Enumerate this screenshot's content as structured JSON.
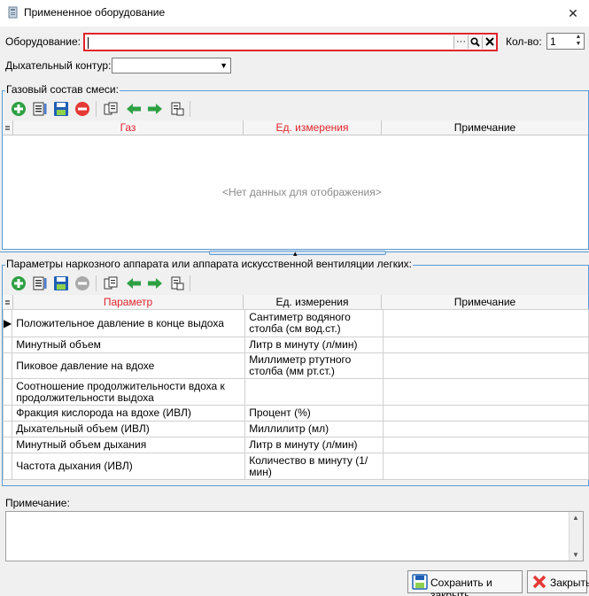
{
  "window": {
    "title": "Примененное оборудование",
    "close_glyph": "✕"
  },
  "form": {
    "equipment_label": "Оборудование:",
    "equipment_value": "",
    "ellipsis_glyph": "···",
    "qty_label": "Кол-во:",
    "qty_value": "1",
    "breathing_label": "Дыхательный контур:",
    "breathing_value": ""
  },
  "gas_section": {
    "title": "Газовый состав смеси:",
    "columns": [
      "Газ",
      "Ед. измерения",
      "Примечание"
    ],
    "empty_text": "<Нет данных для отображения>"
  },
  "params_section": {
    "title": "Параметры наркозного аппарата или аппарата искусственной вентиляции легких:",
    "columns": [
      "Параметр",
      "Ед. измерения",
      "Примечание"
    ],
    "rows": [
      {
        "param": "Положительное давление в конце выдоха",
        "unit": "Сантиметр водяного столба (см вод.ст.)",
        "note": ""
      },
      {
        "param": "Минутный объем",
        "unit": "Литр в минуту (л/мин)",
        "note": ""
      },
      {
        "param": "Пиковое давление на вдохе",
        "unit": "Миллиметр ртутного столба (мм рт.ст.)",
        "note": ""
      },
      {
        "param": "Соотношение продолжительности вдоха к продолжительности выдоха",
        "unit": "",
        "note": ""
      },
      {
        "param": "Фракция кислорода на вдохе (ИВЛ)",
        "unit": "Процент (%)",
        "note": ""
      },
      {
        "param": "Дыхательный объем (ИВЛ)",
        "unit": "Миллилитр (мл)",
        "note": ""
      },
      {
        "param": "Минутный объем дыхания",
        "unit": "Литр в минуту (л/мин)",
        "note": ""
      },
      {
        "param": "Частота дыхания (ИВЛ)",
        "unit": "Количество в минуту (1/мин)",
        "note": ""
      }
    ]
  },
  "notes": {
    "label": "Примечание:",
    "value": ""
  },
  "buttons": {
    "save_close": "Сохранить и закрыть",
    "close": "Закрыть"
  },
  "colors": {
    "accent_red": "#e0252b",
    "group_blue": "#5b9bd5",
    "icon_green": "#2ea043",
    "icon_red": "#e53935"
  }
}
